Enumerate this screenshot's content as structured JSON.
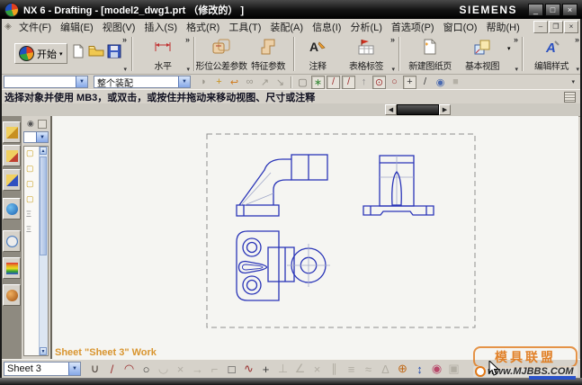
{
  "window": {
    "title": "NX 6 - Drafting - [model2_dwg1.prt （修改的） ]",
    "brand": "SIEMENS",
    "controls": [
      {
        "name": "minimize-button",
        "glyph": "_"
      },
      {
        "name": "maximize-button",
        "glyph": "□"
      },
      {
        "name": "close-button",
        "glyph": "×"
      }
    ],
    "doc_controls": [
      {
        "name": "doc-minimize-button",
        "glyph": "–"
      },
      {
        "name": "doc-restore-button",
        "glyph": "❐"
      },
      {
        "name": "doc-close-button",
        "glyph": "×"
      }
    ]
  },
  "menubar": {
    "items": [
      {
        "label": "文件(F)"
      },
      {
        "label": "编辑(E)"
      },
      {
        "label": "视图(V)"
      },
      {
        "label": "插入(S)"
      },
      {
        "label": "格式(R)"
      },
      {
        "label": "工具(T)"
      },
      {
        "label": "装配(A)"
      },
      {
        "label": "信息(I)"
      },
      {
        "label": "分析(L)"
      },
      {
        "label": "首选项(P)"
      },
      {
        "label": "窗口(O)"
      },
      {
        "label": "帮助(H)"
      }
    ]
  },
  "toolbar": {
    "overflow_glyph": "»",
    "caret_glyph": "▾",
    "start_label": "开始",
    "horizontal_label": "水平",
    "gdt_label": "形位公差参数",
    "feature_label": "特征参数",
    "note_label": "注释",
    "table_label": "表格标签",
    "new_sheet_label": "新建图纸页",
    "base_view_label": "基本视图",
    "edit_style_label": "编辑样式"
  },
  "selection_bar": {
    "filter_value": "",
    "scope_value": "整个装配",
    "icons": [
      {
        "name": "show-only-icon",
        "glyph": "◗",
        "color": "#9a968c"
      },
      {
        "name": "work-layer-icon",
        "glyph": "+",
        "color": "#c8921c"
      },
      {
        "name": "undo-icon",
        "glyph": "↩",
        "color": "#d07818"
      },
      {
        "name": "binocular-icon",
        "glyph": "∞",
        "color": "#9a968c"
      },
      {
        "name": "promote-icon",
        "glyph": "↗",
        "color": "#9a968c"
      },
      {
        "name": "drag-icon",
        "glyph": "↘",
        "color": "#9a968c"
      }
    ],
    "snap_icons": [
      {
        "name": "selection-rectangle-icon",
        "glyph": "▢",
        "color": "#7a766c"
      },
      {
        "name": "snap-point-toggle-icon",
        "glyph": "∗",
        "color": "#3a8a3a",
        "boxed": true
      },
      {
        "name": "end-point-snap-icon",
        "glyph": "/",
        "color": "#a03434",
        "boxed": true
      },
      {
        "name": "mid-point-snap-icon",
        "glyph": "/",
        "color": "#a03434",
        "boxed": true
      },
      {
        "name": "control-point-snap-icon",
        "glyph": "↑",
        "color": "#8a8a8a"
      },
      {
        "name": "arc-center-snap-icon",
        "glyph": "⊙",
        "color": "#a03434",
        "boxed": true
      },
      {
        "name": "quadrant-point-snap-icon",
        "glyph": "○",
        "color": "#a03434"
      },
      {
        "name": "existing-point-snap-icon",
        "glyph": "+",
        "color": "#3a3a3a",
        "boxed": true
      },
      {
        "name": "point-on-curve-snap-icon",
        "glyph": "/",
        "color": "#3a3a3a"
      },
      {
        "name": "point-on-surface-snap-icon",
        "glyph": "◉",
        "color": "#4a6ab0"
      },
      {
        "name": "datum-plane-snap-icon",
        "glyph": "■",
        "color": "#b4b0a6"
      }
    ]
  },
  "prompt": {
    "text": "选择对象并使用 MB3，或双击，或按住并拖动来移动视图、尺寸或注释"
  },
  "resource_bar": {
    "tabs": [
      {
        "name": "assembly-navigator-tab",
        "iconBg": "linear-gradient(135deg,#f0d060 50%,#c89020 50%)"
      },
      {
        "name": "constraint-navigator-tab",
        "iconBg": "linear-gradient(135deg,#f0d060 60%,#c04030 60%)"
      },
      {
        "name": "part-navigator-tab",
        "iconBg": "linear-gradient(135deg,#f0d060 50%,#3050c0 50%)"
      },
      {
        "name": "internet-explorer-tab",
        "iconBg": "radial-gradient(circle at 35% 35%,#70c0f0,#1a60b0)",
        "round": true
      },
      {
        "name": "history-tab",
        "iconBg": "radial-gradient(circle at 50% 50%,#ececec 55%,#5080c0 60%)",
        "round": true
      },
      {
        "name": "palettes-tab",
        "iconBg": "linear-gradient(180deg,#e03030,#e8a020,#e8e020,#30a030,#3050d0)"
      },
      {
        "name": "roles-tab",
        "iconBg": "radial-gradient(circle at 35% 35%,#f0b060,#a05010)",
        "round": true
      }
    ]
  },
  "flyout": {
    "items": [
      {
        "name": "nav-node-icon",
        "glyph": "▢",
        "color": "#c8a020"
      },
      {
        "name": "nav-node-icon",
        "glyph": "▢",
        "color": "#c8a020"
      },
      {
        "name": "nav-node-icon",
        "glyph": "▢",
        "color": "#c8a020"
      },
      {
        "name": "nav-node-icon",
        "glyph": "▢",
        "color": "#c8a020"
      },
      {
        "name": "nav-sheet-icon",
        "glyph": "Ξ",
        "color": "#8a8a8a"
      },
      {
        "name": "nav-sheet-icon",
        "glyph": "Ξ",
        "color": "#8a8a8a"
      }
    ]
  },
  "canvas": {
    "sheet_status": "Sheet \"Sheet 3\" Work"
  },
  "bottom_toolbar": {
    "sheet_value": "Sheet 3",
    "tools": [
      {
        "name": "profile-tool",
        "glyph": "∪",
        "color": "#4a4038"
      },
      {
        "name": "line-tool",
        "glyph": "/",
        "color": "#9a3030"
      },
      {
        "name": "arc-tool",
        "glyph": "◠",
        "color": "#9a3030"
      },
      {
        "name": "circle-tool",
        "glyph": "○",
        "color": "#3a3a3a"
      },
      {
        "name": "fillet-tool",
        "glyph": "◡",
        "color": "#b2aea4"
      },
      {
        "name": "quick-trim-tool",
        "glyph": "×",
        "color": "#b2aea4"
      },
      {
        "name": "quick-extend-tool",
        "glyph": "→",
        "color": "#b2aea4"
      },
      {
        "name": "make-corner-tool",
        "glyph": "⌐",
        "color": "#b2aea4"
      },
      {
        "name": "rectangle-tool",
        "glyph": "□",
        "color": "#3a3a3a"
      },
      {
        "name": "studio-spline-tool",
        "glyph": "∿",
        "color": "#9a3030"
      },
      {
        "name": "point-tool",
        "glyph": "+",
        "color": "#3a3a3a"
      },
      {
        "name": "constraints-tool",
        "glyph": "⊥",
        "color": "#b2aea4"
      },
      {
        "name": "auto-constrain-tool",
        "glyph": "∠",
        "color": "#b2aea4"
      },
      {
        "name": "show-constraints-tool",
        "glyph": "×",
        "color": "#b2aea4"
      },
      {
        "name": "pattern-curve-tool",
        "glyph": "∥",
        "color": "#b2aea4"
      },
      {
        "name": "mirror-curve-tool",
        "glyph": "≡",
        "color": "#b2aea4"
      },
      {
        "name": "offset-curve-tool",
        "glyph": "≈",
        "color": "#b2aea4"
      },
      {
        "name": "edit-curve-tool",
        "glyph": "Δ",
        "color": "#b2aea4"
      },
      {
        "name": "add-point-tool",
        "glyph": "⊕",
        "color": "#c06a1a"
      },
      {
        "name": "dimension-tool",
        "glyph": "↕",
        "color": "#2a52b0"
      },
      {
        "name": "bounded-plane-tool",
        "glyph": "◉",
        "color": "#b8486a"
      },
      {
        "name": "datum-tool",
        "glyph": "▣",
        "color": "#b2aea4"
      }
    ]
  },
  "watermark": {
    "line1": "模具联盟",
    "line2": "www.MJBBS.COM"
  },
  "colors": {
    "line_blue": "#2a35b8",
    "chrome": "#d6d2ca",
    "canvas_bg": "#f5f5f2",
    "sheet_text_orange": "#d9952f",
    "watermark_orange": "#e07818"
  }
}
